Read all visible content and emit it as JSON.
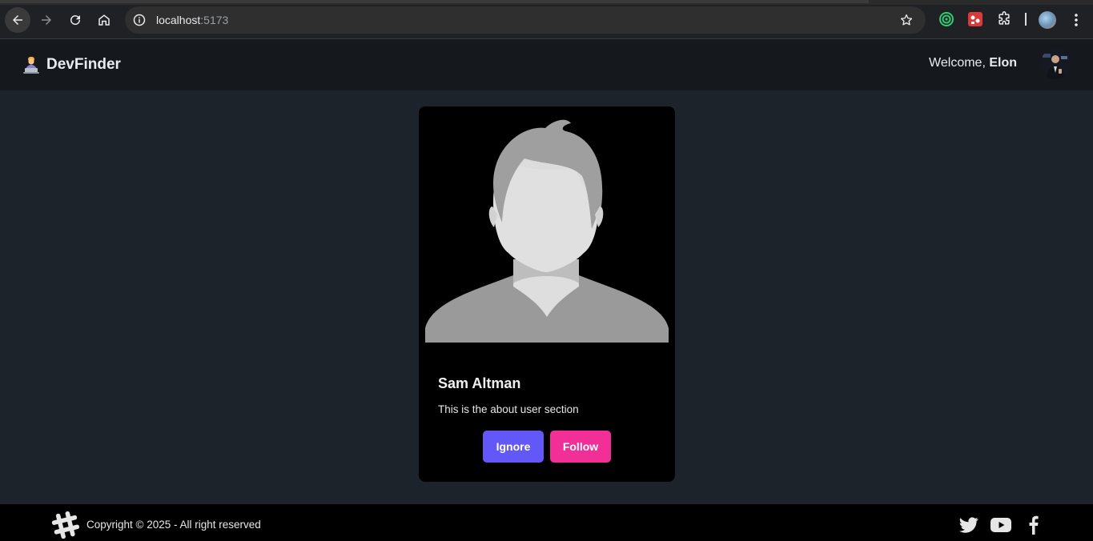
{
  "browser": {
    "url_host": "localhost",
    "url_port": ":5173"
  },
  "navbar": {
    "brand_title": "DevFinder",
    "brand_icon": "technologist-emoji-icon",
    "welcome_prefix": "Welcome, ",
    "user_name": "Elon"
  },
  "card": {
    "name": "Sam Altman",
    "about": "This is the about user section",
    "ignore_label": "Ignore",
    "follow_label": "Follow"
  },
  "footer": {
    "copyright": "Copyright © 2025 - All right reserved",
    "social": [
      "twitter-icon",
      "youtube-icon",
      "facebook-icon"
    ]
  },
  "colors": {
    "page_bg": "#1d232a",
    "navbar_bg": "#15191e",
    "card_bg": "#000000",
    "ignore_button": "#6158f7",
    "follow_button": "#f22f97",
    "footer_bg": "#000000"
  }
}
